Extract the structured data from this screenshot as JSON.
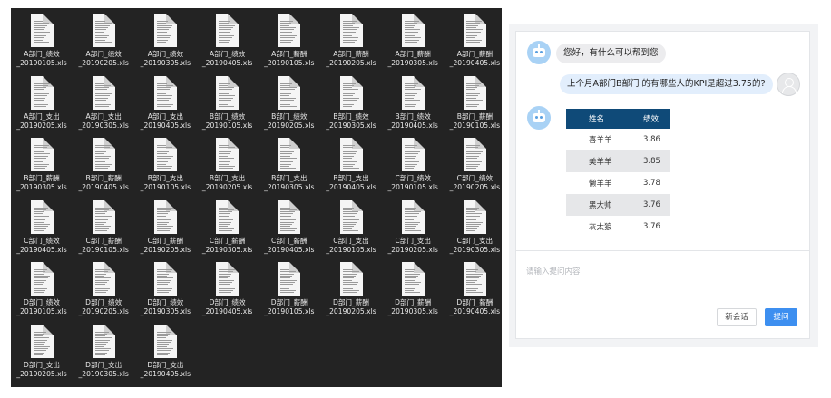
{
  "files": [
    {
      "line1": "A部门_绩效",
      "line2": "_20190105.xls"
    },
    {
      "line1": "A部门_绩效",
      "line2": "_20190205.xls"
    },
    {
      "line1": "A部门_绩效",
      "line2": "_20190305.xls"
    },
    {
      "line1": "A部门_绩效",
      "line2": "_20190405.xls"
    },
    {
      "line1": "A部门_薪酬",
      "line2": "_20190105.xls"
    },
    {
      "line1": "A部门_薪酬",
      "line2": "_20190205.xls"
    },
    {
      "line1": "A部门_薪酬",
      "line2": "_20190305.xls"
    },
    {
      "line1": "A部门_薪酬",
      "line2": "_20190405.xls"
    },
    {
      "line1": "A部门_支出",
      "line2": "_20190205.xls"
    },
    {
      "line1": "A部门_支出",
      "line2": "_20190305.xls"
    },
    {
      "line1": "A部门_支出",
      "line2": "_20190405.xls"
    },
    {
      "line1": "B部门_绩效",
      "line2": "_20190105.xls"
    },
    {
      "line1": "B部门_绩效",
      "line2": "_20190205.xls"
    },
    {
      "line1": "B部门_绩效",
      "line2": "_20190305.xls"
    },
    {
      "line1": "B部门_绩效",
      "line2": "_20190405.xls"
    },
    {
      "line1": "B部门_薪酬",
      "line2": "_20190105.xls"
    },
    {
      "line1": "B部门_薪酬",
      "line2": "_20190305.xls"
    },
    {
      "line1": "B部门_薪酬",
      "line2": "_20190405.xls"
    },
    {
      "line1": "B部门_支出",
      "line2": "_20190105.xls"
    },
    {
      "line1": "B部门_支出",
      "line2": "_20190205.xls"
    },
    {
      "line1": "B部门_支出",
      "line2": "_20190305.xls"
    },
    {
      "line1": "B部门_支出",
      "line2": "_20190405.xls"
    },
    {
      "line1": "C部门_绩效",
      "line2": "_20190105.xls"
    },
    {
      "line1": "C部门_绩效",
      "line2": "_20190205.xls"
    },
    {
      "line1": "C部门_绩效",
      "line2": "_20190405.xls"
    },
    {
      "line1": "C部门_薪酬",
      "line2": "_20190105.xls"
    },
    {
      "line1": "C部门_薪酬",
      "line2": "_20190205.xls"
    },
    {
      "line1": "C部门_薪酬",
      "line2": "_20190305.xls"
    },
    {
      "line1": "C部门_薪酬",
      "line2": "_20190405.xls"
    },
    {
      "line1": "C部门_支出",
      "line2": "_20190105.xls"
    },
    {
      "line1": "C部门_支出",
      "line2": "_20190205.xls"
    },
    {
      "line1": "C部门_支出",
      "line2": "_20190305.xls"
    },
    {
      "line1": "D部门_绩效",
      "line2": "_20190105.xls"
    },
    {
      "line1": "D部门_绩效",
      "line2": "_20190205.xls"
    },
    {
      "line1": "D部门_绩效",
      "line2": "_20190305.xls"
    },
    {
      "line1": "D部门_绩效",
      "line2": "_20190405.xls"
    },
    {
      "line1": "D部门_薪酬",
      "line2": "_20190105.xls"
    },
    {
      "line1": "D部门_薪酬",
      "line2": "_20190205.xls"
    },
    {
      "line1": "D部门_薪酬",
      "line2": "_20190305.xls"
    },
    {
      "line1": "D部门_薪酬",
      "line2": "_20190405.xls"
    },
    {
      "line1": "D部门_支出",
      "line2": "_20190205.xls"
    },
    {
      "line1": "D部门_支出",
      "line2": "_20190305.xls"
    },
    {
      "line1": "D部门_支出",
      "line2": "_20190405.xls"
    }
  ],
  "chat": {
    "bot_greeting": "您好，有什么可以帮到您",
    "user_question": "上个月A部门B部门 的有哪些人的KPI是超过3.75的?",
    "table": {
      "headers": [
        "姓名",
        "绩效"
      ],
      "rows": [
        [
          "喜羊羊",
          "3.86"
        ],
        [
          "美羊羊",
          "3.85"
        ],
        [
          "懒羊羊",
          "3.78"
        ],
        [
          "黑大帅",
          "3.76"
        ],
        [
          "灰太狼",
          "3.76"
        ]
      ]
    },
    "input_placeholder": "请输入提问内容",
    "new_chat_label": "新会话",
    "ask_label": "提问"
  },
  "colors": {
    "file_panel_bg": "#232323",
    "table_header_bg": "#0f4a78",
    "ask_button": "#3d8ff0",
    "user_bubble": "#e2eefc"
  }
}
